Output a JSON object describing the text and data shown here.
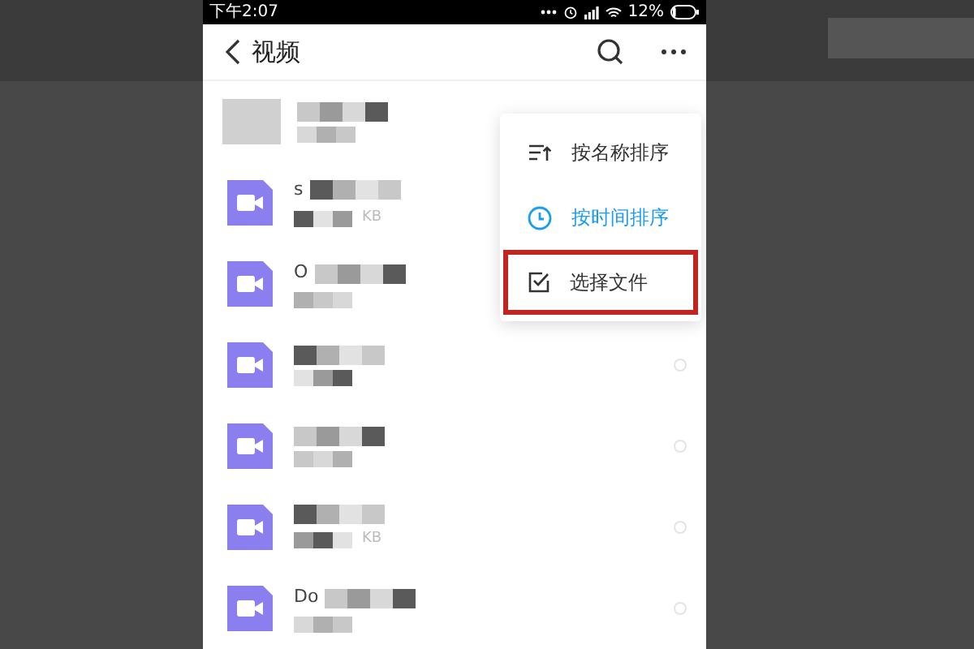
{
  "status_bar": {
    "time": "下午2:07",
    "battery": "12%"
  },
  "header": {
    "title": "视频"
  },
  "files": [
    {
      "kind": "thumbnail"
    },
    {
      "kind": "video",
      "name": "s",
      "size": "KB"
    },
    {
      "kind": "video",
      "name": "O"
    },
    {
      "kind": "video"
    },
    {
      "kind": "video"
    },
    {
      "kind": "video",
      "size": "KB"
    },
    {
      "kind": "video",
      "name": "Do"
    }
  ],
  "menu": [
    {
      "kind": "sort-name",
      "label": "按名称排序",
      "selected": false,
      "highlighted": false
    },
    {
      "kind": "sort-time",
      "label": "按时间排序",
      "selected": true,
      "highlighted": false
    },
    {
      "kind": "select",
      "label": "选择文件",
      "selected": false,
      "highlighted": true
    }
  ]
}
